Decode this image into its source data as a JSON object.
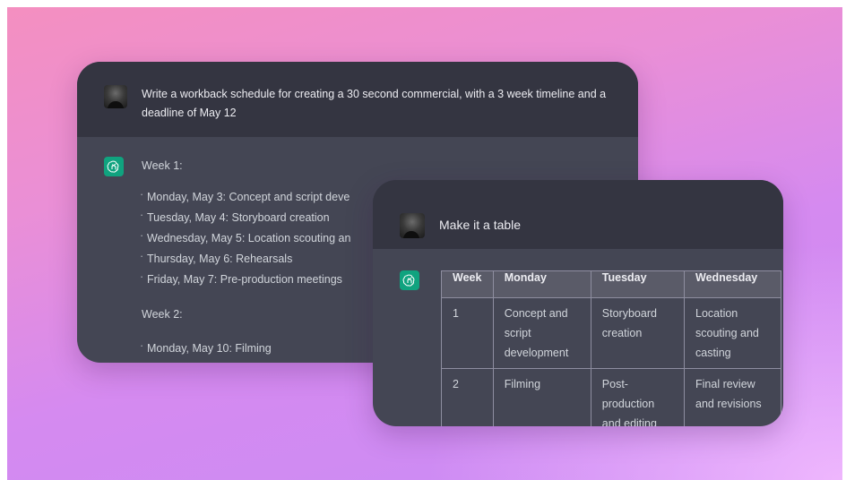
{
  "back_card": {
    "user_message": "Write a workback schedule for creating a 30 second commercial, with a 3 week timeline and a deadline of May 12",
    "week1_label": "Week 1:",
    "week1_items": [
      "Monday, May 3: Concept and script deve",
      "Tuesday, May 4: Storyboard creation",
      "Wednesday, May 5: Location scouting an",
      "Thursday, May 6: Rehearsals",
      "Friday, May 7: Pre-production meetings"
    ],
    "week2_label": "Week 2:",
    "week2_items": [
      "Monday, May 10: Filming"
    ]
  },
  "front_card": {
    "user_message": "Make it a table",
    "table": {
      "headers": [
        "Week",
        "Monday",
        "Tuesday",
        "Wednesday"
      ],
      "rows": [
        [
          "1",
          "Concept and script development",
          "Storyboard creation",
          "Location scouting and casting"
        ],
        [
          "2",
          "Filming",
          "Post-production and editing",
          "Final review and revisions"
        ]
      ]
    }
  },
  "icons": {
    "assistant": "chatgpt-logo-icon",
    "user": "user-avatar"
  },
  "colors": {
    "assistant_icon_bg": "#10a37f",
    "user_row_bg": "#343541",
    "assistant_row_bg": "#444654"
  }
}
